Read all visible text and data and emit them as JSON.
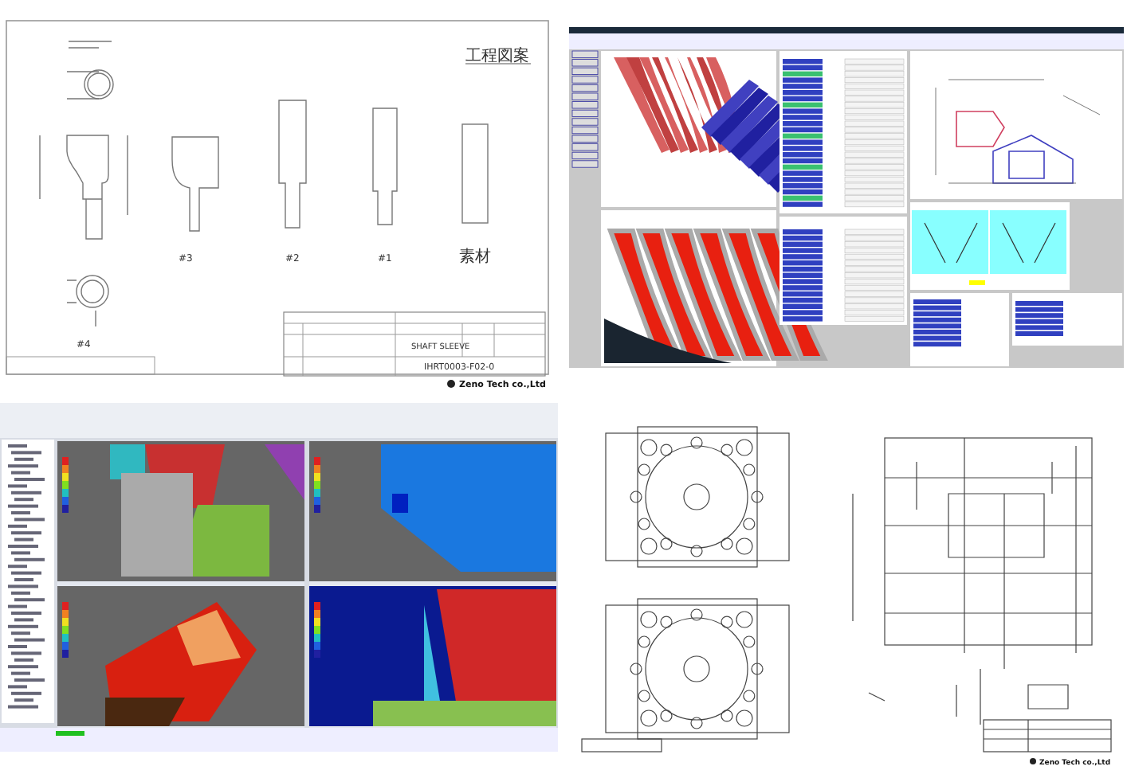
{
  "panels": [
    {
      "kind": "part-drawing",
      "title": "工程図案",
      "steps": [
        {
          "label": "#3"
        },
        {
          "label": "#2"
        },
        {
          "label": "#1"
        },
        {
          "label": "素材"
        }
      ],
      "detail_label": "#4",
      "part_name": "SHAFT SLEEVE",
      "drawing_number": "IHRT0003-F02-0",
      "logo": "Zeno Tech co.,Ltd"
    },
    {
      "kind": "gear-software"
    },
    {
      "kind": "cae-software"
    },
    {
      "kind": "mold-drawing",
      "logo": "Zeno Tech co.,Ltd"
    }
  ]
}
